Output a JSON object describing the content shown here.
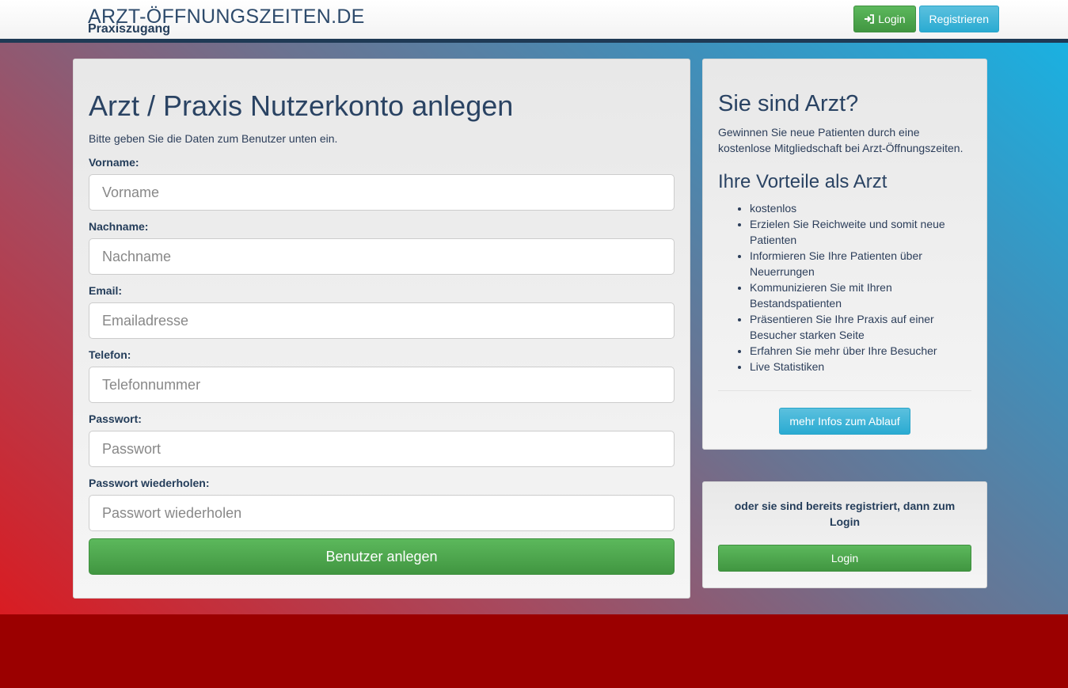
{
  "header": {
    "brand_title": "ARZT-ÖFFNUNGSZEITEN.DE",
    "brand_subtitle": "Praxiszugang",
    "login_label": "Login",
    "register_label": "Registrieren"
  },
  "form": {
    "title": "Arzt / Praxis Nutzerkonto anlegen",
    "intro": "Bitte geben Sie die Daten zum Benutzer unten ein.",
    "fields": [
      {
        "label": "Vorname:",
        "placeholder": "Vorname",
        "value": ""
      },
      {
        "label": "Nachname:",
        "placeholder": "Nachname",
        "value": ""
      },
      {
        "label": "Email:",
        "placeholder": "Emailadresse",
        "value": ""
      },
      {
        "label": "Telefon:",
        "placeholder": "Telefonnummer",
        "value": ""
      },
      {
        "label": "Passwort:",
        "placeholder": "Passwort",
        "value": ""
      },
      {
        "label": "Passwort wiederholen:",
        "placeholder": "Passwort wiederholen",
        "value": ""
      }
    ],
    "submit_label": "Benutzer anlegen"
  },
  "sidebar": {
    "title": "Sie sind Arzt?",
    "intro": "Gewinnen Sie neue Patienten durch eine kostenlose Mitgliedschaft bei Arzt-Öffnungszeiten.",
    "subtitle": "Ihre Vorteile als Arzt",
    "benefits": [
      "kostenlos",
      "Erzielen Sie Reichweite und somit neue Patienten",
      "Informieren Sie Ihre Patienten über Neuerrungen",
      "Kommunizieren Sie mit Ihren Bestandspatienten",
      "Präsentieren Sie Ihre Praxis auf einer Besucher starken Seite",
      "Erfahren Sie mehr über Ihre Besucher",
      "Live Statistiken"
    ],
    "more_info_label": "mehr Infos zum Ablauf"
  },
  "login_box": {
    "text": "oder sie sind bereits registriert, dann zum Login",
    "button_label": "Login"
  },
  "colors": {
    "navy": "#1f3a55",
    "green": "#5cb85c",
    "info_blue": "#5bc0de",
    "footer_red": "#9b0000"
  }
}
